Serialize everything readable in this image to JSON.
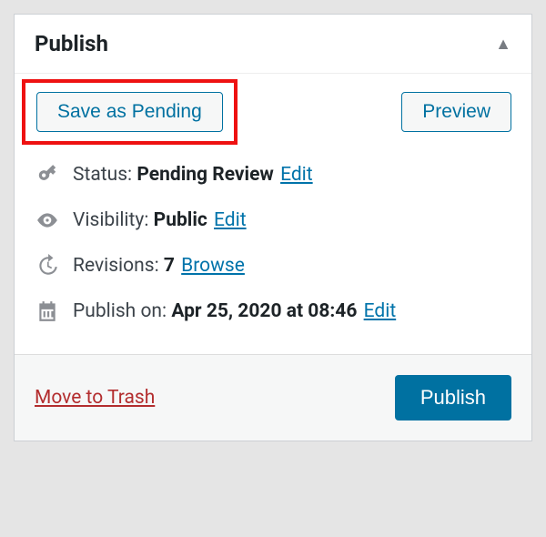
{
  "panel": {
    "title": "Publish",
    "actions": {
      "save_label": "Save as Pending",
      "preview_label": "Preview"
    },
    "status": {
      "label": "Status:",
      "value": "Pending Review",
      "edit_label": "Edit"
    },
    "visibility": {
      "label": "Visibility:",
      "value": "Public",
      "edit_label": "Edit"
    },
    "revisions": {
      "label": "Revisions:",
      "value": "7",
      "browse_label": "Browse"
    },
    "schedule": {
      "label": "Publish on:",
      "value": "Apr 25, 2020 at 08:46",
      "edit_label": "Edit"
    },
    "footer": {
      "trash_label": "Move to Trash",
      "publish_label": "Publish"
    }
  }
}
